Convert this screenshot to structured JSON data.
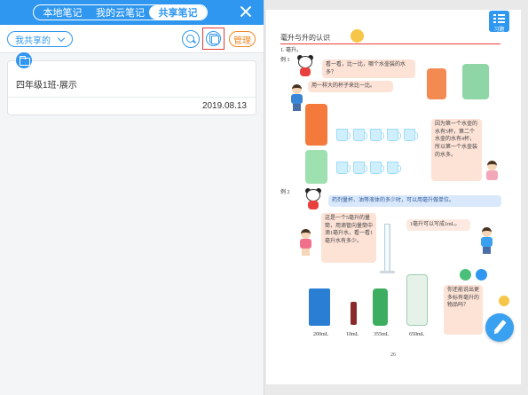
{
  "panel": {
    "tabs": [
      {
        "label": "本地笔记",
        "active": false
      },
      {
        "label": "我的云笔记",
        "active": false
      },
      {
        "label": "共享笔记",
        "active": true
      }
    ],
    "filter_label": "我共享的",
    "manage_label": "管理",
    "notes": [
      {
        "title": "四年级1班-展示",
        "date": "2019.08.13"
      }
    ]
  },
  "page": {
    "exercise_label": "习题",
    "lesson_title": "毫升与升的认识",
    "section_label": "1. 毫升。",
    "example1_label": "例 1",
    "bubble1": "看一看，比一比，哪个水壶装的水多？",
    "bubble2": "用一样大的杯子来比一比。",
    "bubble3": "因为第一个水壶的水有5杯，第二个水壶的水有4杯，所以第一个水壶装的水多。",
    "example2_label": "例 2",
    "bubble4": "药剂量杯、油等液体的多少时，可以用毫升做单位。",
    "bubble5": "这是一个5毫升的量筒，用滴管向量筒中滴1毫升水，看一看1毫升水有多少。",
    "bubble6": "1毫升可以写成1mL。",
    "bubble7": "你还能说出更多标有毫升的物品吗？",
    "products": [
      "200mL",
      "10mL",
      "355mL",
      "650mL"
    ],
    "page_number": "26"
  },
  "colors": {
    "primary": "#2f97ef",
    "highlight": "#e23a3a",
    "manage": "#f08a2a",
    "bubble": "#fde2d6"
  }
}
